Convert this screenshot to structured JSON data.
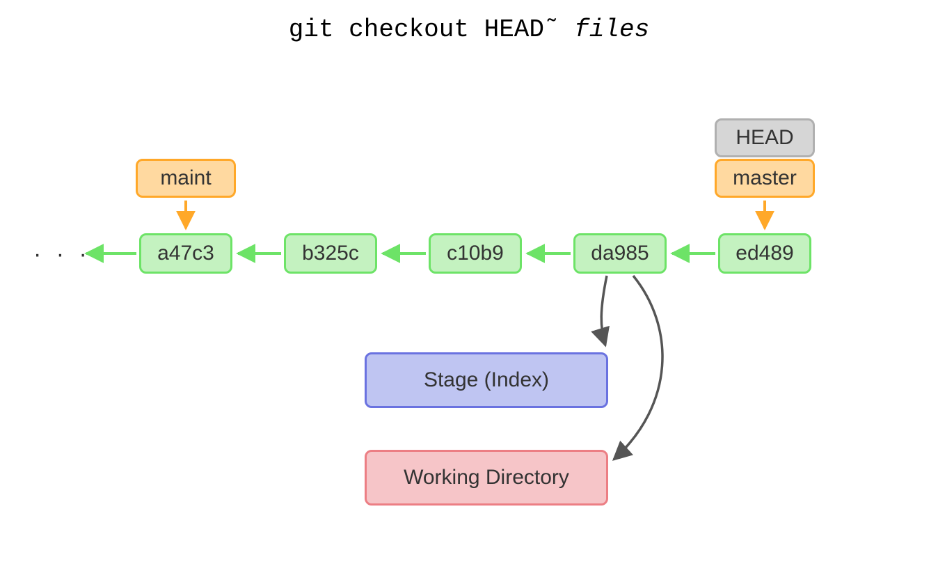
{
  "title_prefix": "git checkout HEAD˜ ",
  "title_arg": "files",
  "ellipsis": "· · ·",
  "commits": {
    "c1": "a47c3",
    "c2": "b325c",
    "c3": "c10b9",
    "c4": "da985",
    "c5": "ed489"
  },
  "branches": {
    "maint": "maint",
    "master": "master"
  },
  "head_label": "HEAD",
  "stage_label": "Stage (Index)",
  "workdir_label": "Working Directory",
  "colors": {
    "commit_fill": "#c4f2c0",
    "commit_stroke": "#6de367",
    "branch_fill": "#ffd9a0",
    "branch_stroke": "#ffa829",
    "head_fill": "#d6d6d6",
    "head_stroke": "#b0b0b0",
    "stage_fill": "#bfc5f2",
    "stage_stroke": "#6a72e0",
    "workdir_fill": "#f6c5c8",
    "workdir_stroke": "#ec7e84",
    "dark_arrow": "#555555"
  }
}
